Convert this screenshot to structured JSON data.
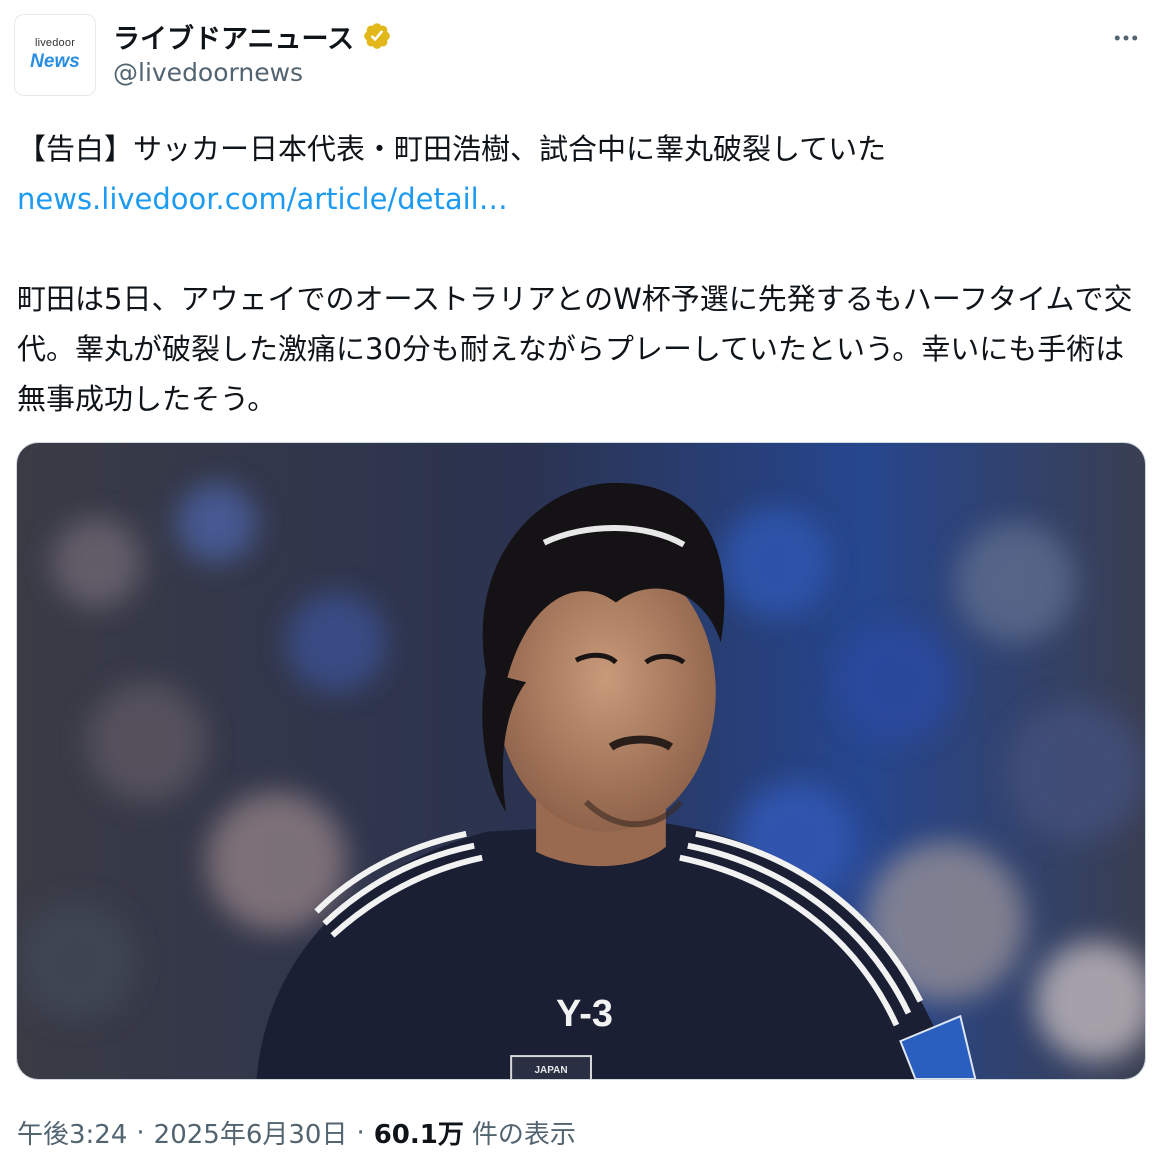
{
  "author": {
    "avatar_small": "livedoor",
    "avatar_big": "News",
    "display_name": "ライブドアニュース",
    "handle": "@livedoornews",
    "verified_color": "#e2b719"
  },
  "tweet": {
    "line1": "【告白】サッカー日本代表・町田浩樹、試合中に睾丸破裂していた",
    "link": "news.livedoor.com/article/detail…",
    "body": "町田は5日、アウェイでのオーストラリアとのW杯予選に先発するもハーフタイムで交代。睾丸が破裂した激痛に30分も耐えながらプレーしていたという。幸いにも手術は無事成功したそう。",
    "link_color": "#1d9bf0"
  },
  "media": {
    "jersey_logo": "Y-3",
    "jersey_badge": "JAPAN"
  },
  "footer": {
    "time": "午後3:24",
    "separator": "·",
    "date": "2025年6月30日",
    "views": "60.1万",
    "views_label": "件の表示"
  }
}
